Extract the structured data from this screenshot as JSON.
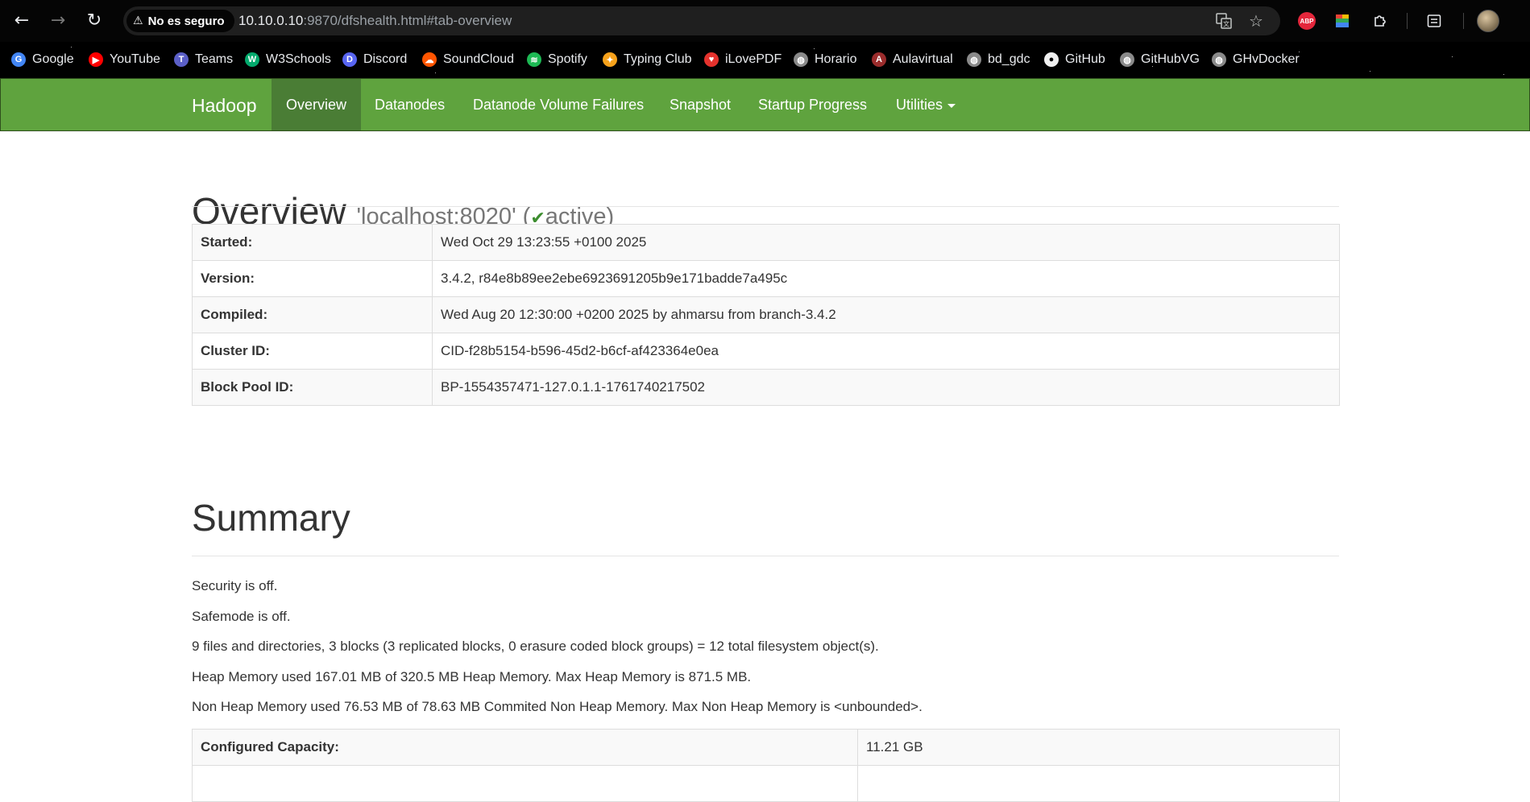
{
  "browser": {
    "security_label": "No es seguro",
    "url_host": "10.10.0.10",
    "url_rest": ":9870/dfshealth.html#tab-overview",
    "icons": {
      "back": "back-arrow-icon",
      "forward": "forward-arrow-icon",
      "reload": "reload-icon",
      "translate": "translate-icon",
      "bookmark": "bookmark-star-icon",
      "adblock": "ABP",
      "extension_color": "color-extension-icon",
      "extensions": "puzzle-icon",
      "reading_list": "reading-list-icon",
      "profile": "profile-avatar"
    }
  },
  "bookmarks": [
    {
      "label": "Google",
      "icon": "google-icon",
      "color": "#4285f4",
      "glyph": "G"
    },
    {
      "label": "YouTube",
      "icon": "youtube-icon",
      "color": "#ff0000",
      "glyph": "▶"
    },
    {
      "label": "Teams",
      "icon": "teams-icon",
      "color": "#5b5fc7",
      "glyph": "T"
    },
    {
      "label": "W3Schools",
      "icon": "w3schools-icon",
      "color": "#04aa6d",
      "glyph": "W"
    },
    {
      "label": "Discord",
      "icon": "discord-icon",
      "color": "#5865f2",
      "glyph": "D"
    },
    {
      "label": "SoundCloud",
      "icon": "soundcloud-icon",
      "color": "#ff5500",
      "glyph": "☁"
    },
    {
      "label": "Spotify",
      "icon": "spotify-icon",
      "color": "#1db954",
      "glyph": "≋"
    },
    {
      "label": "Typing Club",
      "icon": "typingclub-icon",
      "color": "#f7a21b",
      "glyph": "✦"
    },
    {
      "label": "iLovePDF",
      "icon": "ilovepdf-icon",
      "color": "#e5322d",
      "glyph": "♥"
    },
    {
      "label": "Horario",
      "icon": "globe-icon",
      "color": "#8a8a8a",
      "glyph": "◍"
    },
    {
      "label": "Aulavirtual",
      "icon": "aulavirtual-icon",
      "color": "#9b2c2c",
      "glyph": "A"
    },
    {
      "label": "bd_gdc",
      "icon": "globe-icon",
      "color": "#8a8a8a",
      "glyph": "◍"
    },
    {
      "label": "GitHub",
      "icon": "github-icon",
      "color": "#f0f0f0",
      "glyph": "●"
    },
    {
      "label": "GitHubVG",
      "icon": "globe-icon",
      "color": "#8a8a8a",
      "glyph": "◍"
    },
    {
      "label": "GHvDocker",
      "icon": "globe-icon",
      "color": "#8a8a8a",
      "glyph": "◍"
    }
  ],
  "navbar": {
    "brand": "Hadoop",
    "items": [
      {
        "label": "Overview",
        "active": true
      },
      {
        "label": "Datanodes",
        "active": false
      },
      {
        "label": "Datanode Volume Failures",
        "active": false
      },
      {
        "label": "Snapshot",
        "active": false
      },
      {
        "label": "Startup Progress",
        "active": false
      },
      {
        "label": "Utilities",
        "active": false,
        "dropdown": true
      }
    ]
  },
  "overview": {
    "title": "Overview",
    "host": "'localhost:8020' (",
    "status": "active",
    "status_close": ")",
    "rows": [
      {
        "key": "Started:",
        "value": "Wed Oct 29 13:23:55 +0100 2025"
      },
      {
        "key": "Version:",
        "value": "3.4.2, r84e8b89ee2ebe6923691205b9e171badde7a495c"
      },
      {
        "key": "Compiled:",
        "value": "Wed Aug 20 12:30:00 +0200 2025 by ahmarsu from branch-3.4.2"
      },
      {
        "key": "Cluster ID:",
        "value": "CID-f28b5154-b596-45d2-b6cf-af423364e0ea"
      },
      {
        "key": "Block Pool ID:",
        "value": "BP-1554357471-127.0.1.1-1761740217502"
      }
    ]
  },
  "summary": {
    "title": "Summary",
    "lines": [
      "Security is off.",
      "Safemode is off.",
      "9 files and directories, 3 blocks (3 replicated blocks, 0 erasure coded block groups) = 12 total filesystem object(s).",
      "Heap Memory used 167.01 MB of 320.5 MB Heap Memory. Max Heap Memory is 871.5 MB.",
      "Non Heap Memory used 76.53 MB of 78.63 MB Commited Non Heap Memory. Max Non Heap Memory is <unbounded>."
    ],
    "table": [
      {
        "key": "Configured Capacity:",
        "value": "11.21 GB"
      },
      {
        "key": "",
        "value": ""
      }
    ]
  }
}
